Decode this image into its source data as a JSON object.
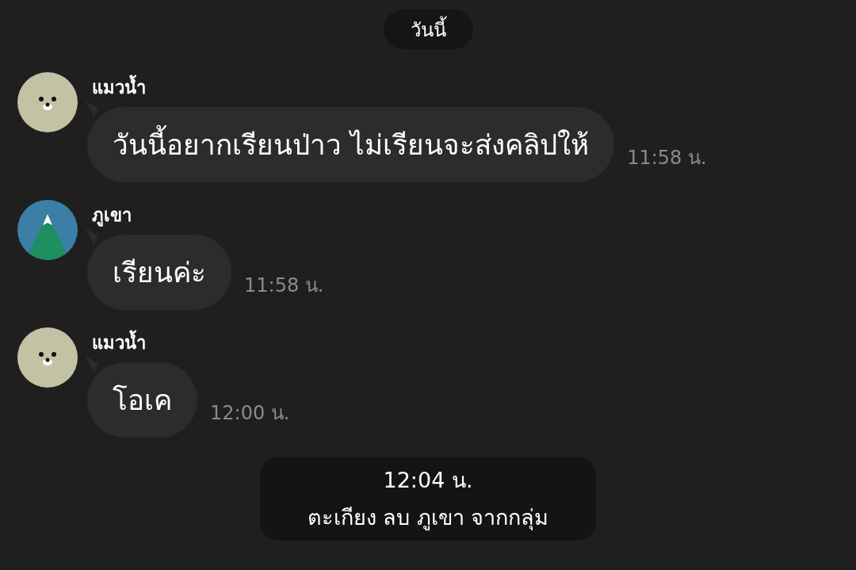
{
  "date_divider": "วันนี้",
  "messages": [
    {
      "sender": "แมวน้ำ",
      "kind": "seal",
      "text": "วันนี้อยากเรียนป่าว ไม่เรียนจะส่งคลิปให้",
      "time": "11:58 น."
    },
    {
      "sender": "ภูเขา",
      "kind": "mountain",
      "text": "เรียนค่ะ",
      "time": "11:58 น."
    },
    {
      "sender": "แมวน้ำ",
      "kind": "seal",
      "text": "โอเค",
      "time": "12:00 น."
    }
  ],
  "system_notice": {
    "time": "12:04 น.",
    "text": "ตะเกียง ลบ ภูเขา จากกลุ่ม"
  }
}
